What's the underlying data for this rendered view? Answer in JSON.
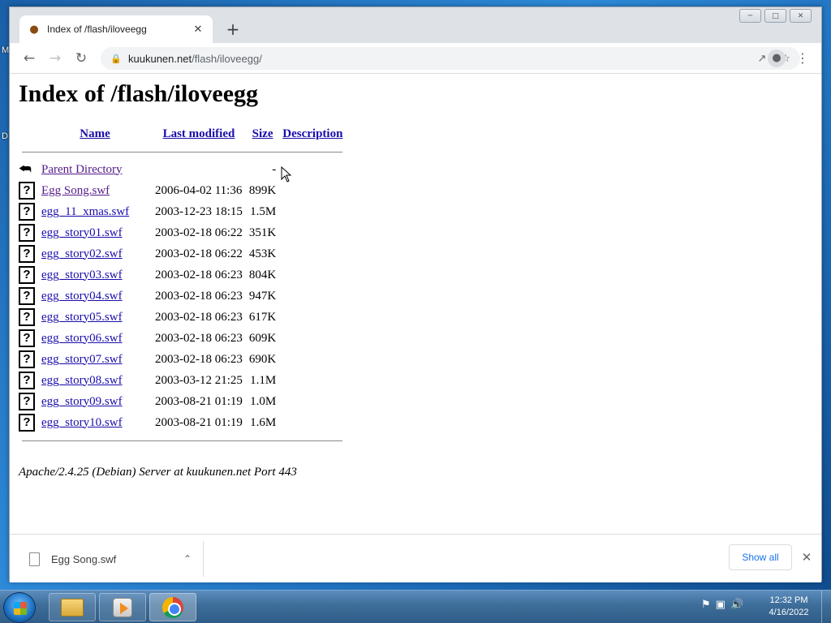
{
  "desktop": {
    "left_letter_top": "M",
    "left_letter_mid": "D"
  },
  "tab": {
    "title": "Index of /flash/iloveegg",
    "favicon": "egg-icon"
  },
  "window_controls": {
    "minimize": "minimize-icon",
    "maximize": "maximize-icon",
    "close": "close-icon"
  },
  "address": {
    "host": "kuukunen.net",
    "path": "/flash/iloveegg/"
  },
  "page": {
    "title": "Index of /flash/iloveegg",
    "columns": {
      "name": "Name",
      "modified": "Last modified",
      "size": "Size",
      "description": "Description"
    },
    "parent": {
      "name": "Parent Directory",
      "size": "-"
    },
    "rows": [
      {
        "name": "Egg Song.swf",
        "modified": "2006-04-02 11:36",
        "size": "899K"
      },
      {
        "name": "egg_11_xmas.swf",
        "modified": "2003-12-23 18:15",
        "size": "1.5M"
      },
      {
        "name": "egg_story01.swf",
        "modified": "2003-02-18 06:22",
        "size": "351K"
      },
      {
        "name": "egg_story02.swf",
        "modified": "2003-02-18 06:22",
        "size": "453K"
      },
      {
        "name": "egg_story03.swf",
        "modified": "2003-02-18 06:23",
        "size": "804K"
      },
      {
        "name": "egg_story04.swf",
        "modified": "2003-02-18 06:23",
        "size": "947K"
      },
      {
        "name": "egg_story05.swf",
        "modified": "2003-02-18 06:23",
        "size": "617K"
      },
      {
        "name": "egg_story06.swf",
        "modified": "2003-02-18 06:23",
        "size": "609K"
      },
      {
        "name": "egg_story07.swf",
        "modified": "2003-02-18 06:23",
        "size": "690K"
      },
      {
        "name": "egg_story08.swf",
        "modified": "2003-03-12 21:25",
        "size": "1.1M"
      },
      {
        "name": "egg_story09.swf",
        "modified": "2003-08-21 01:19",
        "size": "1.0M"
      },
      {
        "name": "egg_story10.swf",
        "modified": "2003-08-21 01:19",
        "size": "1.6M"
      }
    ],
    "footer": "Apache/2.4.25 (Debian) Server at kuukunen.net Port 443"
  },
  "downloads": {
    "file": "Egg Song.swf",
    "show_all": "Show all"
  },
  "taskbar": {
    "time": "12:32 PM",
    "date": "4/16/2022"
  },
  "colors": {
    "link": "#1a0dab",
    "visited": "#551a8b",
    "accent": "#1a73e8"
  }
}
